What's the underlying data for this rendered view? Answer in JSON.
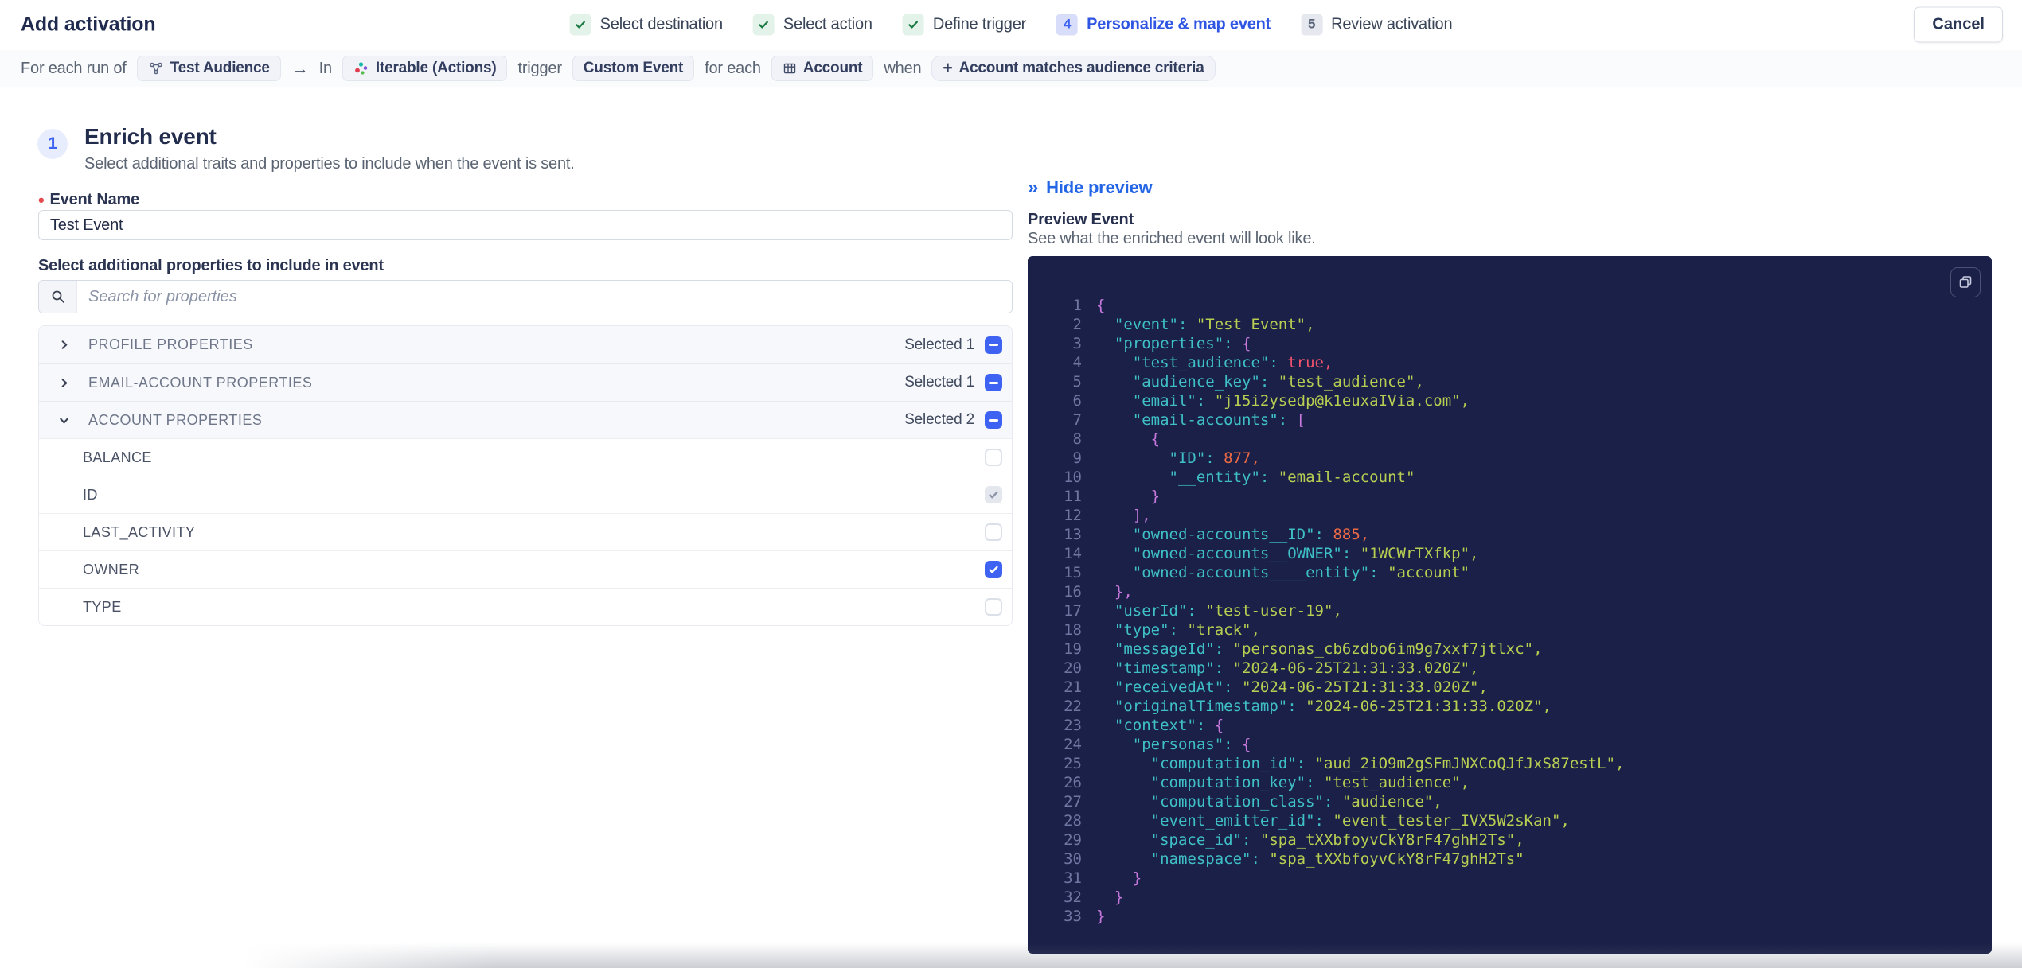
{
  "colors": {
    "accent_blue": "#3E63F2",
    "link_blue": "#2465E6",
    "success_green": "#1B7A41",
    "success_bg": "#E4F3EA",
    "required_red": "#E5484D",
    "code_bg": "#1A2047",
    "code_key": "#3FC0C6",
    "code_string": "#B8CE52",
    "code_number": "#ED6A45",
    "code_boolean": "#F2536D",
    "code_brace": "#C678DD"
  },
  "header": {
    "title": "Add activation",
    "cancel_label": "Cancel",
    "steps": [
      {
        "label": "Select destination",
        "state": "done"
      },
      {
        "label": "Select action",
        "state": "done"
      },
      {
        "label": "Define trigger",
        "state": "done"
      },
      {
        "label": "Personalize & map event",
        "state": "active",
        "number": "4"
      },
      {
        "label": "Review activation",
        "state": "upcoming",
        "number": "5"
      }
    ]
  },
  "icons": {
    "arrow": "→",
    "plus": "+",
    "collapse": "»",
    "required_dot": "•"
  },
  "context_bar": {
    "prefix": "For each run of",
    "audience_chip": "Test Audience",
    "in_word": "In",
    "destination_chip": "Iterable (Actions)",
    "trigger_word": "trigger",
    "event_chip": "Custom Event",
    "for_each_word": "for each",
    "entity_chip": "Account",
    "when_word": "when",
    "criteria_chip": "Account matches audience criteria"
  },
  "enrich": {
    "step_number": "1",
    "title": "Enrich event",
    "subtitle": "Select additional traits and properties to include when the event is sent.",
    "event_name_label": "Event Name",
    "event_name_value": "Test Event",
    "properties_label": "Select additional properties to include in event",
    "search_placeholder": "Search for properties"
  },
  "properties_panel": {
    "groups": [
      {
        "label": "PROFILE PROPERTIES",
        "selected_label": "Selected 1",
        "expanded": false
      },
      {
        "label": "EMAIL-ACCOUNT PROPERTIES",
        "selected_label": "Selected 1",
        "expanded": false
      },
      {
        "label": "ACCOUNT PROPERTIES",
        "selected_label": "Selected 2",
        "expanded": true
      }
    ],
    "account_properties": [
      {
        "label": "BALANCE",
        "state": "unchecked"
      },
      {
        "label": "ID",
        "state": "checked-disabled"
      },
      {
        "label": "LAST_ACTIVITY",
        "state": "unchecked"
      },
      {
        "label": "OWNER",
        "state": "checked"
      },
      {
        "label": "TYPE",
        "state": "unchecked"
      }
    ]
  },
  "preview": {
    "hide_label": "Hide preview",
    "title": "Preview Event",
    "subtitle": "See what the enriched event will look like.",
    "code_lines": [
      {
        "i": 0,
        "t": [
          [
            "brace",
            "{"
          ]
        ]
      },
      {
        "i": 2,
        "t": [
          [
            "key",
            "\"event\": "
          ],
          [
            "str",
            "\"Test Event\","
          ]
        ]
      },
      {
        "i": 2,
        "t": [
          [
            "key",
            "\"properties\": "
          ],
          [
            "brace",
            "{"
          ]
        ]
      },
      {
        "i": 4,
        "t": [
          [
            "key",
            "\"test_audience\": "
          ],
          [
            "bool",
            "true,"
          ]
        ]
      },
      {
        "i": 4,
        "t": [
          [
            "key",
            "\"audience_key\": "
          ],
          [
            "str",
            "\"test_audience\","
          ]
        ]
      },
      {
        "i": 4,
        "t": [
          [
            "key",
            "\"email\": "
          ],
          [
            "str",
            "\"j15i2ysedp@k1euxaIVia.com\","
          ]
        ]
      },
      {
        "i": 4,
        "t": [
          [
            "key",
            "\"email-accounts\": "
          ],
          [
            "brace",
            "["
          ]
        ]
      },
      {
        "i": 6,
        "t": [
          [
            "brace",
            "{"
          ]
        ]
      },
      {
        "i": 8,
        "t": [
          [
            "key",
            "\"ID\": "
          ],
          [
            "num",
            "877,"
          ]
        ]
      },
      {
        "i": 8,
        "t": [
          [
            "key",
            "\"__entity\": "
          ],
          [
            "str",
            "\"email-account\""
          ]
        ]
      },
      {
        "i": 6,
        "t": [
          [
            "brace",
            "}"
          ]
        ]
      },
      {
        "i": 4,
        "t": [
          [
            "brace",
            "],"
          ]
        ]
      },
      {
        "i": 4,
        "t": [
          [
            "key",
            "\"owned-accounts__ID\": "
          ],
          [
            "num",
            "885,"
          ]
        ]
      },
      {
        "i": 4,
        "t": [
          [
            "key",
            "\"owned-accounts__OWNER\": "
          ],
          [
            "str",
            "\"1WCWrTXfkp\","
          ]
        ]
      },
      {
        "i": 4,
        "t": [
          [
            "key",
            "\"owned-accounts____entity\": "
          ],
          [
            "str",
            "\"account\""
          ]
        ]
      },
      {
        "i": 2,
        "t": [
          [
            "brace",
            "},"
          ]
        ]
      },
      {
        "i": 2,
        "t": [
          [
            "key",
            "\"userId\": "
          ],
          [
            "str",
            "\"test-user-19\","
          ]
        ]
      },
      {
        "i": 2,
        "t": [
          [
            "key",
            "\"type\": "
          ],
          [
            "str",
            "\"track\","
          ]
        ]
      },
      {
        "i": 2,
        "t": [
          [
            "key",
            "\"messageId\": "
          ],
          [
            "str",
            "\"personas_cb6zdbo6im9g7xxf7jtlxc\","
          ]
        ]
      },
      {
        "i": 2,
        "t": [
          [
            "key",
            "\"timestamp\": "
          ],
          [
            "str",
            "\"2024-06-25T21:31:33.020Z\","
          ]
        ]
      },
      {
        "i": 2,
        "t": [
          [
            "key",
            "\"receivedAt\": "
          ],
          [
            "str",
            "\"2024-06-25T21:31:33.020Z\","
          ]
        ]
      },
      {
        "i": 2,
        "t": [
          [
            "key",
            "\"originalTimestamp\": "
          ],
          [
            "str",
            "\"2024-06-25T21:31:33.020Z\","
          ]
        ]
      },
      {
        "i": 2,
        "t": [
          [
            "key",
            "\"context\": "
          ],
          [
            "brace",
            "{"
          ]
        ]
      },
      {
        "i": 4,
        "t": [
          [
            "key",
            "\"personas\": "
          ],
          [
            "brace",
            "{"
          ]
        ]
      },
      {
        "i": 6,
        "t": [
          [
            "key",
            "\"computation_id\": "
          ],
          [
            "str",
            "\"aud_2iO9m2gSFmJNXCoQJfJxS87estL\","
          ]
        ]
      },
      {
        "i": 6,
        "t": [
          [
            "key",
            "\"computation_key\": "
          ],
          [
            "str",
            "\"test_audience\","
          ]
        ]
      },
      {
        "i": 6,
        "t": [
          [
            "key",
            "\"computation_class\": "
          ],
          [
            "str",
            "\"audience\","
          ]
        ]
      },
      {
        "i": 6,
        "t": [
          [
            "key",
            "\"event_emitter_id\": "
          ],
          [
            "str",
            "\"event_tester_IVX5W2sKan\","
          ]
        ]
      },
      {
        "i": 6,
        "t": [
          [
            "key",
            "\"space_id\": "
          ],
          [
            "str",
            "\"spa_tXXbfoyvCkY8rF47ghH2Ts\","
          ]
        ]
      },
      {
        "i": 6,
        "t": [
          [
            "key",
            "\"namespace\": "
          ],
          [
            "str",
            "\"spa_tXXbfoyvCkY8rF47ghH2Ts\""
          ]
        ]
      },
      {
        "i": 4,
        "t": [
          [
            "brace",
            "}"
          ]
        ]
      },
      {
        "i": 2,
        "t": [
          [
            "brace",
            "}"
          ]
        ]
      },
      {
        "i": 0,
        "t": [
          [
            "brace",
            "}"
          ]
        ]
      }
    ]
  }
}
